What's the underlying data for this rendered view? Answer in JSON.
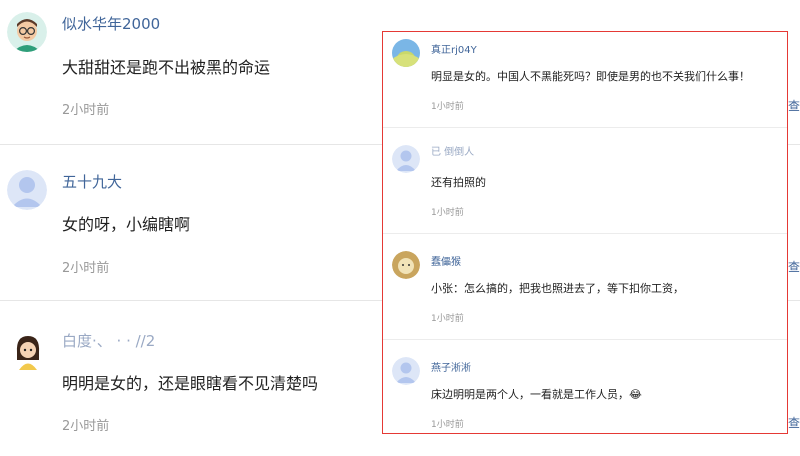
{
  "comments": [
    {
      "username": "似水华年2000",
      "text": "大甜甜还是跑不出被黑的命运",
      "time": "2小时前"
    },
    {
      "username": "五十九大",
      "text": "女的呀，小编瞎啊",
      "time": "2小时前"
    },
    {
      "username": "白度·、  ·  ·  //2",
      "text": "明明是女的，还是眼瞎看不见清楚吗",
      "time": "2小时前"
    }
  ],
  "replies": {
    "items": [
      {
        "username": "真正rj04Y",
        "text": "明显是女的。中国人不黑能死吗？即使是男的也不关我们什么事！",
        "time": "1小时前"
      },
      {
        "username": "已  倒倒人",
        "text": "还有拍照的",
        "time": "1小时前"
      },
      {
        "username": "蠢儡猴",
        "text": "小张：怎么搞的，把我也照进去了，等下扣你工资，",
        "time": "1小时前"
      },
      {
        "username": "燕子淅淅",
        "text": "床边明明是两个人，一看就是工作人员，😂",
        "time": "1小时前"
      }
    ]
  },
  "edge_links": [
    "查",
    "查",
    "查"
  ],
  "colors": {
    "username": "#406599",
    "highlight_border": "#e53935",
    "meta": "#999999"
  }
}
